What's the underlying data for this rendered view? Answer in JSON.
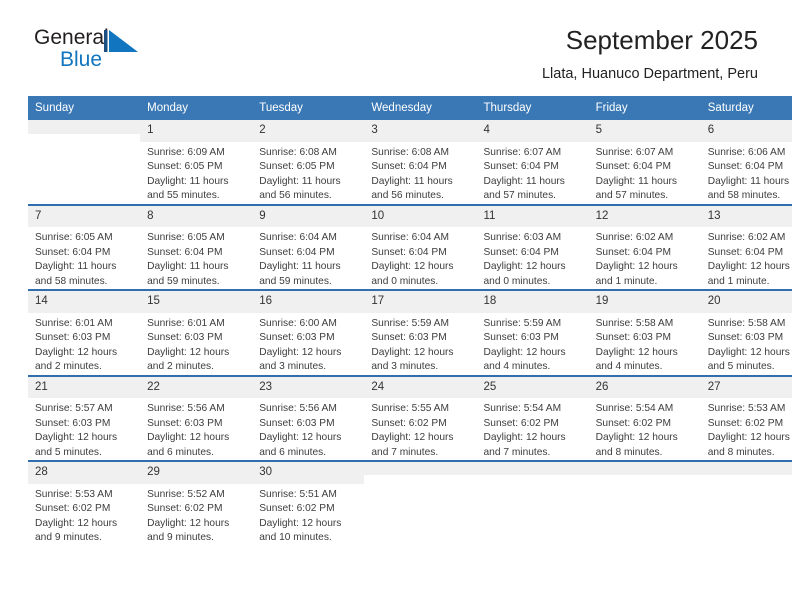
{
  "brand": {
    "name_top": "General",
    "name_bottom": "Blue",
    "mark": "triangle-logo",
    "colors": {
      "blue": "#1175c0",
      "dark": "#231f20"
    }
  },
  "header": {
    "title": "September 2025",
    "subtitle": "Llata, Huanuco Department, Peru"
  },
  "theme": {
    "header_blue": "#3a78b5",
    "daynum_gray": "#f0f0f0",
    "week_divider": "#2f6fad"
  },
  "weekday_headers": [
    "Sunday",
    "Monday",
    "Tuesday",
    "Wednesday",
    "Thursday",
    "Friday",
    "Saturday"
  ],
  "weeks": [
    [
      {
        "day": "",
        "empty": true
      },
      {
        "day": "1",
        "sunrise": "Sunrise: 6:09 AM",
        "sunset": "Sunset: 6:05 PM",
        "daylight_1": "Daylight: 11 hours",
        "daylight_2": "and 55 minutes."
      },
      {
        "day": "2",
        "sunrise": "Sunrise: 6:08 AM",
        "sunset": "Sunset: 6:05 PM",
        "daylight_1": "Daylight: 11 hours",
        "daylight_2": "and 56 minutes."
      },
      {
        "day": "3",
        "sunrise": "Sunrise: 6:08 AM",
        "sunset": "Sunset: 6:04 PM",
        "daylight_1": "Daylight: 11 hours",
        "daylight_2": "and 56 minutes."
      },
      {
        "day": "4",
        "sunrise": "Sunrise: 6:07 AM",
        "sunset": "Sunset: 6:04 PM",
        "daylight_1": "Daylight: 11 hours",
        "daylight_2": "and 57 minutes."
      },
      {
        "day": "5",
        "sunrise": "Sunrise: 6:07 AM",
        "sunset": "Sunset: 6:04 PM",
        "daylight_1": "Daylight: 11 hours",
        "daylight_2": "and 57 minutes."
      },
      {
        "day": "6",
        "sunrise": "Sunrise: 6:06 AM",
        "sunset": "Sunset: 6:04 PM",
        "daylight_1": "Daylight: 11 hours",
        "daylight_2": "and 58 minutes."
      }
    ],
    [
      {
        "day": "7",
        "sunrise": "Sunrise: 6:05 AM",
        "sunset": "Sunset: 6:04 PM",
        "daylight_1": "Daylight: 11 hours",
        "daylight_2": "and 58 minutes."
      },
      {
        "day": "8",
        "sunrise": "Sunrise: 6:05 AM",
        "sunset": "Sunset: 6:04 PM",
        "daylight_1": "Daylight: 11 hours",
        "daylight_2": "and 59 minutes."
      },
      {
        "day": "9",
        "sunrise": "Sunrise: 6:04 AM",
        "sunset": "Sunset: 6:04 PM",
        "daylight_1": "Daylight: 11 hours",
        "daylight_2": "and 59 minutes."
      },
      {
        "day": "10",
        "sunrise": "Sunrise: 6:04 AM",
        "sunset": "Sunset: 6:04 PM",
        "daylight_1": "Daylight: 12 hours",
        "daylight_2": "and 0 minutes."
      },
      {
        "day": "11",
        "sunrise": "Sunrise: 6:03 AM",
        "sunset": "Sunset: 6:04 PM",
        "daylight_1": "Daylight: 12 hours",
        "daylight_2": "and 0 minutes."
      },
      {
        "day": "12",
        "sunrise": "Sunrise: 6:02 AM",
        "sunset": "Sunset: 6:04 PM",
        "daylight_1": "Daylight: 12 hours",
        "daylight_2": "and 1 minute."
      },
      {
        "day": "13",
        "sunrise": "Sunrise: 6:02 AM",
        "sunset": "Sunset: 6:04 PM",
        "daylight_1": "Daylight: 12 hours",
        "daylight_2": "and 1 minute."
      }
    ],
    [
      {
        "day": "14",
        "sunrise": "Sunrise: 6:01 AM",
        "sunset": "Sunset: 6:03 PM",
        "daylight_1": "Daylight: 12 hours",
        "daylight_2": "and 2 minutes."
      },
      {
        "day": "15",
        "sunrise": "Sunrise: 6:01 AM",
        "sunset": "Sunset: 6:03 PM",
        "daylight_1": "Daylight: 12 hours",
        "daylight_2": "and 2 minutes."
      },
      {
        "day": "16",
        "sunrise": "Sunrise: 6:00 AM",
        "sunset": "Sunset: 6:03 PM",
        "daylight_1": "Daylight: 12 hours",
        "daylight_2": "and 3 minutes."
      },
      {
        "day": "17",
        "sunrise": "Sunrise: 5:59 AM",
        "sunset": "Sunset: 6:03 PM",
        "daylight_1": "Daylight: 12 hours",
        "daylight_2": "and 3 minutes."
      },
      {
        "day": "18",
        "sunrise": "Sunrise: 5:59 AM",
        "sunset": "Sunset: 6:03 PM",
        "daylight_1": "Daylight: 12 hours",
        "daylight_2": "and 4 minutes."
      },
      {
        "day": "19",
        "sunrise": "Sunrise: 5:58 AM",
        "sunset": "Sunset: 6:03 PM",
        "daylight_1": "Daylight: 12 hours",
        "daylight_2": "and 4 minutes."
      },
      {
        "day": "20",
        "sunrise": "Sunrise: 5:58 AM",
        "sunset": "Sunset: 6:03 PM",
        "daylight_1": "Daylight: 12 hours",
        "daylight_2": "and 5 minutes."
      }
    ],
    [
      {
        "day": "21",
        "sunrise": "Sunrise: 5:57 AM",
        "sunset": "Sunset: 6:03 PM",
        "daylight_1": "Daylight: 12 hours",
        "daylight_2": "and 5 minutes."
      },
      {
        "day": "22",
        "sunrise": "Sunrise: 5:56 AM",
        "sunset": "Sunset: 6:03 PM",
        "daylight_1": "Daylight: 12 hours",
        "daylight_2": "and 6 minutes."
      },
      {
        "day": "23",
        "sunrise": "Sunrise: 5:56 AM",
        "sunset": "Sunset: 6:03 PM",
        "daylight_1": "Daylight: 12 hours",
        "daylight_2": "and 6 minutes."
      },
      {
        "day": "24",
        "sunrise": "Sunrise: 5:55 AM",
        "sunset": "Sunset: 6:02 PM",
        "daylight_1": "Daylight: 12 hours",
        "daylight_2": "and 7 minutes."
      },
      {
        "day": "25",
        "sunrise": "Sunrise: 5:54 AM",
        "sunset": "Sunset: 6:02 PM",
        "daylight_1": "Daylight: 12 hours",
        "daylight_2": "and 7 minutes."
      },
      {
        "day": "26",
        "sunrise": "Sunrise: 5:54 AM",
        "sunset": "Sunset: 6:02 PM",
        "daylight_1": "Daylight: 12 hours",
        "daylight_2": "and 8 minutes."
      },
      {
        "day": "27",
        "sunrise": "Sunrise: 5:53 AM",
        "sunset": "Sunset: 6:02 PM",
        "daylight_1": "Daylight: 12 hours",
        "daylight_2": "and 8 minutes."
      }
    ],
    [
      {
        "day": "28",
        "sunrise": "Sunrise: 5:53 AM",
        "sunset": "Sunset: 6:02 PM",
        "daylight_1": "Daylight: 12 hours",
        "daylight_2": "and 9 minutes."
      },
      {
        "day": "29",
        "sunrise": "Sunrise: 5:52 AM",
        "sunset": "Sunset: 6:02 PM",
        "daylight_1": "Daylight: 12 hours",
        "daylight_2": "and 9 minutes."
      },
      {
        "day": "30",
        "sunrise": "Sunrise: 5:51 AM",
        "sunset": "Sunset: 6:02 PM",
        "daylight_1": "Daylight: 12 hours",
        "daylight_2": "and 10 minutes."
      },
      {
        "day": "",
        "empty": true
      },
      {
        "day": "",
        "empty": true
      },
      {
        "day": "",
        "empty": true
      },
      {
        "day": "",
        "empty": true
      }
    ]
  ]
}
